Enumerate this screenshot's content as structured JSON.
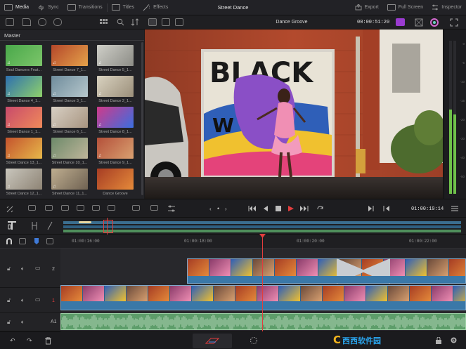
{
  "app": {
    "project_title": "Street Dance",
    "timeline_name": "Dance Groove",
    "viewer_timecode": "00:00:51:20",
    "playhead_timecode": "01:00:19:14"
  },
  "topbar": {
    "media": "Media",
    "sync": "Sync",
    "transitions": "Transitions",
    "titles": "Titles",
    "effects": "Effects",
    "export": "Export",
    "fullscreen": "Full Screen",
    "inspector": "Inspector"
  },
  "media_pool": {
    "bin": "Master",
    "clips": [
      {
        "label": "Soul Dancers Feat...",
        "kind": "audio",
        "c1": "#49a84a",
        "c2": "#7cc56a"
      },
      {
        "label": "Street Dance 7_1...",
        "kind": "video",
        "c1": "#b4472a",
        "c2": "#e5a24a"
      },
      {
        "label": "Street Dance 5_1...",
        "kind": "video",
        "c1": "#cfcfc8",
        "c2": "#8c8c86"
      },
      {
        "label": "Street Dance 4_1...",
        "kind": "video",
        "c1": "#2d6fb0",
        "c2": "#8fd16a"
      },
      {
        "label": "Street Dance 3_1...",
        "kind": "video",
        "c1": "#6f8c9c",
        "c2": "#b6c7cc"
      },
      {
        "label": "Street Dance 2_1...",
        "kind": "video",
        "c1": "#d9d2c0",
        "c2": "#9b8f7a"
      },
      {
        "label": "Street Dance 1_1...",
        "kind": "video",
        "c1": "#c84a6b",
        "c2": "#f08a5a"
      },
      {
        "label": "Street Dance 6_1...",
        "kind": "video",
        "c1": "#d8d0c4",
        "c2": "#a79480"
      },
      {
        "label": "Street Dance 8_1...",
        "kind": "video",
        "c1": "#d03a8a",
        "c2": "#3a6ee0"
      },
      {
        "label": "Street Dance 13_1...",
        "kind": "video",
        "c1": "#c4532d",
        "c2": "#e7b84a"
      },
      {
        "label": "Street Dance 10_1...",
        "kind": "video",
        "c1": "#6d8a6a",
        "c2": "#bfb59a"
      },
      {
        "label": "Street Dance 9_1...",
        "kind": "video",
        "c1": "#b4503a",
        "c2": "#d9a070"
      },
      {
        "label": "Street Dance 12_1...",
        "kind": "video",
        "c1": "#c9c6bd",
        "c2": "#8e8475"
      },
      {
        "label": "Street Dance 11_1...",
        "kind": "video",
        "c1": "#bfae90",
        "c2": "#6f6252"
      },
      {
        "label": "Dance Groove",
        "kind": "timeline",
        "c1": "#a63d24",
        "c2": "#e58a3a"
      }
    ]
  },
  "meter": {
    "ticks": [
      "0",
      "-5",
      "-10",
      "-15",
      "-20",
      "-30",
      "-40",
      "-50"
    ],
    "level_left": 0.55,
    "level_right": 0.52
  },
  "ruler": {
    "marks": [
      "01:00:16:00",
      "01:00:18:00",
      "01:00:20:00",
      "01:00:22:00"
    ]
  },
  "tracks": {
    "v2": "2",
    "v1": "1",
    "a1": "A1"
  },
  "colors": {
    "accent_red": "#e23d3d",
    "audio_green": "#5d9d6a",
    "clip_blue": "#2d5f8a",
    "panel": "#232327"
  }
}
